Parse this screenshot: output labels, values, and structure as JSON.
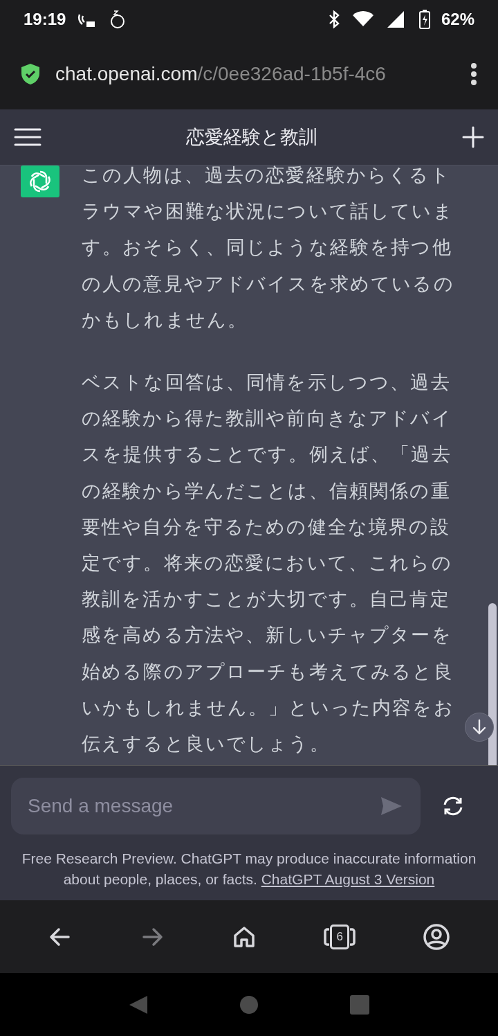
{
  "status_bar": {
    "time": "19:19",
    "battery": "62%"
  },
  "url_bar": {
    "host": "chat.openai.com",
    "path": "/c/0ee326ad-1b5f-4c6"
  },
  "header": {
    "title": "恋愛経験と教訓"
  },
  "messages": [
    {
      "paragraphs": [
        "この人物は、過去の恋愛経験からくるトラウマや困難な状況について話しています。おそらく、同じような経験を持つ他の人の意見やアドバイスを求めているのかもしれません。",
        "ベストな回答は、同情を示しつつ、過去の経験から得た教訓や前向きなアドバイスを提供することです。例えば、「過去の経験から学んだことは、信頼関係の重要性や自分を守るための健全な境界の設定です。将来の恋愛において、これらの教訓を活かすことが大切です。自己肯定感を高める方法や、新しいチャプターを始める際のアプローチも考えてみると良いかもしれません。」といった内容をお伝えすると良いでしょう。"
      ]
    }
  ],
  "composer": {
    "placeholder": "Send a message"
  },
  "footer": {
    "text": "Free Research Preview. ChatGPT may produce inaccurate information about people, places, or facts. ",
    "link": "ChatGPT August 3 Version"
  },
  "browser_nav": [
    {
      "kind": "back",
      "disabled": false
    },
    {
      "kind": "forward",
      "disabled": true
    },
    {
      "kind": "home",
      "disabled": false
    },
    {
      "kind": "tabs",
      "disabled": false,
      "count": "6"
    },
    {
      "kind": "account",
      "disabled": false
    }
  ]
}
